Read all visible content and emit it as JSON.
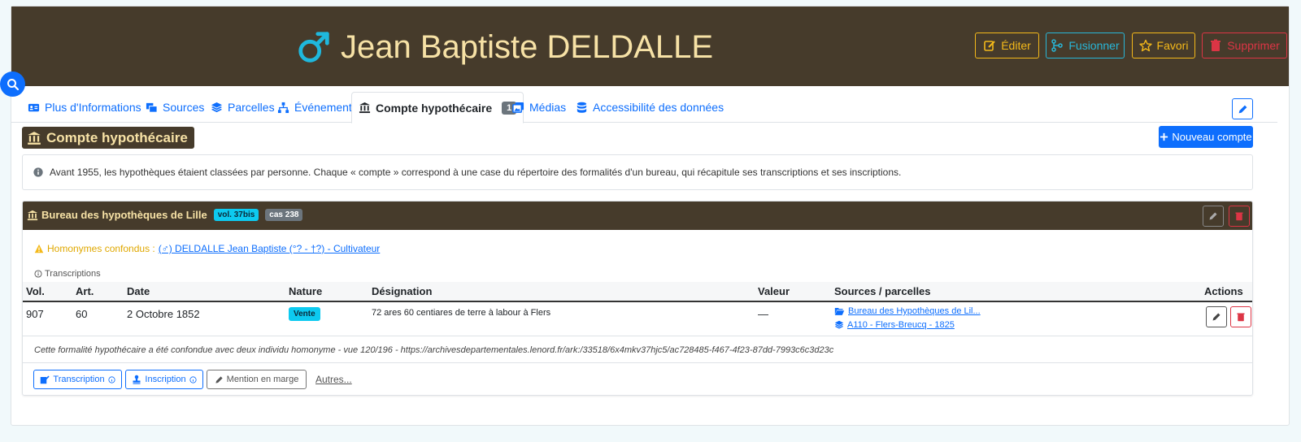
{
  "header": {
    "name": "Jean Baptiste DELDALLE",
    "buttons": {
      "edit": "Éditer",
      "merge": "Fusionner",
      "favorite": "Favori",
      "delete": "Supprimer"
    }
  },
  "tabs": [
    {
      "label": "Plus d'Informations"
    },
    {
      "label": "Sources"
    },
    {
      "label": "Parcelles"
    },
    {
      "label": "Événement"
    },
    {
      "label": "Compte hypothécaire",
      "badge": "1"
    },
    {
      "label": "Médias"
    },
    {
      "label": "Accessibilité des données"
    }
  ],
  "section": {
    "title": "Compte hypothécaire",
    "new_button": "Nouveau compte",
    "info": "Avant 1955, les hypothèques étaient classées par personne. Chaque « compte » correspond à une case du répertoire des formalités d'un bureau, qui récapitule ses transcriptions et ses inscriptions."
  },
  "bureau": {
    "title": "Bureau des hypothèques de Lille",
    "vol_badge": "vol. 37bis",
    "cas_badge": "cas 238",
    "homonymes_label": "Homonymes confondus :",
    "homonymes_link": "(♂) DELDALLE Jean Baptiste (°? - †?) - Cultivateur",
    "transcriptions_label": "Transcriptions",
    "table": {
      "headers": {
        "vol": "Vol.",
        "art": "Art.",
        "date": "Date",
        "nature": "Nature",
        "designation": "Désignation",
        "valeur": "Valeur",
        "sources": "Sources / parcelles",
        "actions": "Actions"
      },
      "rows": [
        {
          "vol": "907",
          "art": "60",
          "date": "2 Octobre 1852",
          "nature": "Vente",
          "designation": "72 ares 60 centiares de terre à labour à Flers",
          "valeur": "—",
          "source1": "Bureau des Hypothèques de Lil...",
          "source2": "A110 - Flers-Breucq - 1825"
        }
      ]
    },
    "note": "Cette formalité hypothécaire a été confondue avec deux individu homonyme - vue 120/196 - https://archivesdepartementales.lenord.fr/ark:/33518/6x4mkv37hjc5/ac728485-f467-4f23-87dd-7993c6c3d23c",
    "footer": {
      "transcription": "Transcription",
      "inscription": "Inscription",
      "mention": "Mention en marge",
      "autres": "Autres..."
    }
  },
  "colors": {
    "brown": "#463b2b",
    "gold": "#f7e2a6",
    "primary": "#0d6efd",
    "cyan": "#0dcaf0",
    "warning": "#f4b91a",
    "danger": "#dc3545"
  }
}
